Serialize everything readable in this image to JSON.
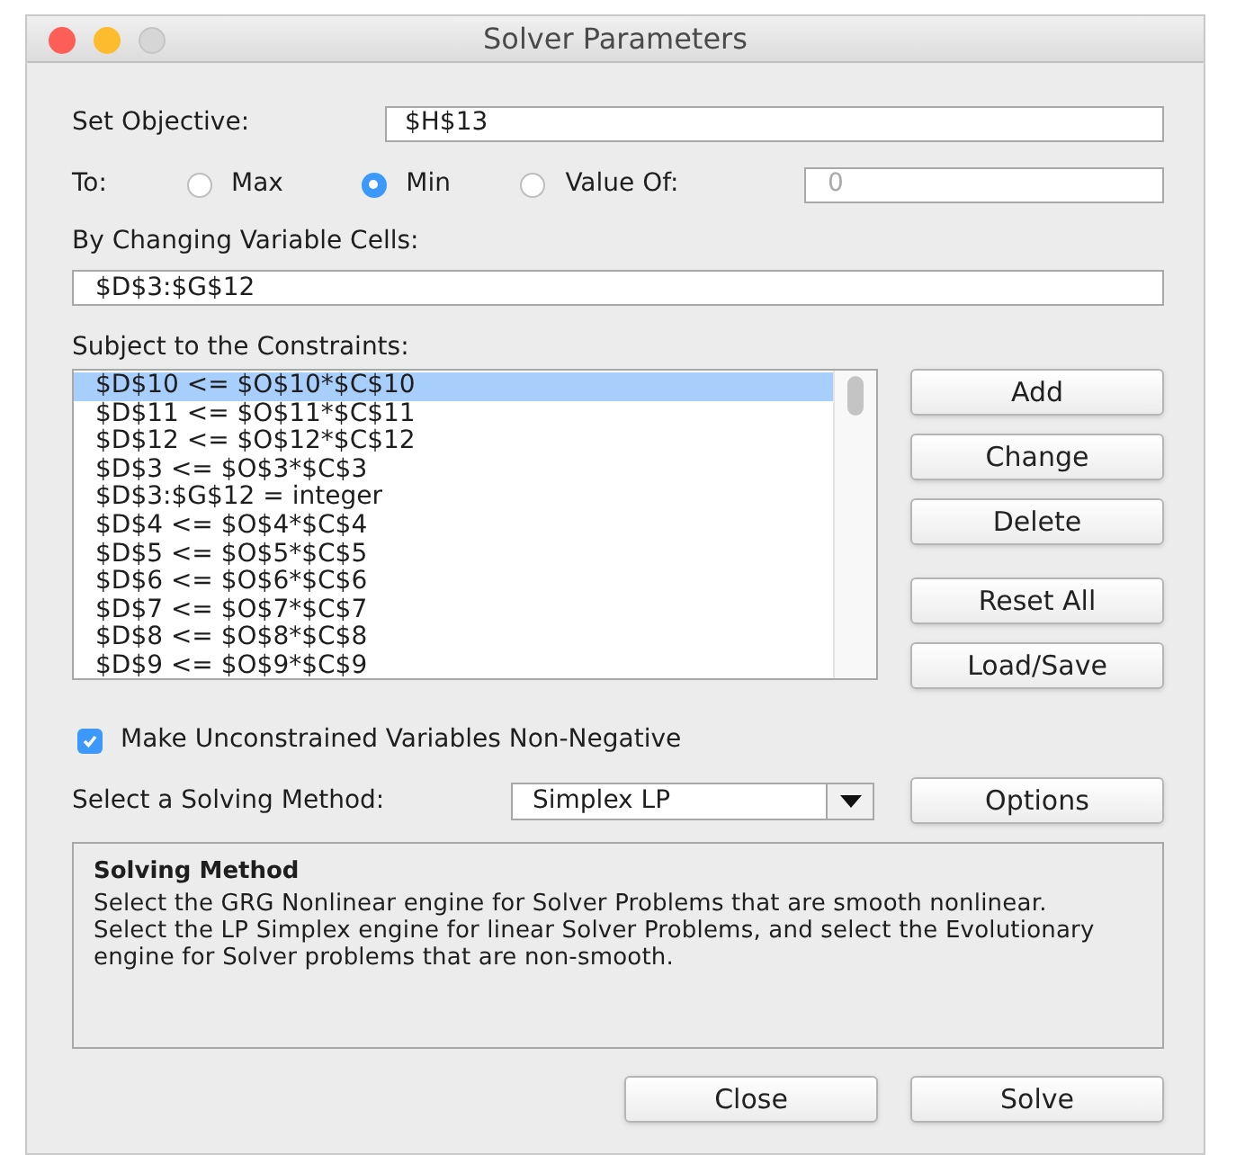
{
  "window": {
    "title": "Solver Parameters"
  },
  "objective": {
    "label": "Set Objective:",
    "value": "$H$13"
  },
  "to": {
    "label": "To:",
    "options": [
      {
        "label": "Max",
        "selected": false
      },
      {
        "label": "Min",
        "selected": true
      },
      {
        "label": "Value Of:",
        "selected": false
      }
    ],
    "value_field": {
      "placeholder": "0"
    }
  },
  "variable_cells": {
    "label": "By Changing Variable Cells:",
    "value": "$D$3:$G$12"
  },
  "constraints": {
    "label": "Subject to the Constraints:",
    "items": [
      {
        "text": "$D$10 <= $O$10*$C$10",
        "selected": true
      },
      {
        "text": "$D$11 <= $O$11*$C$11",
        "selected": false
      },
      {
        "text": "$D$12 <= $O$12*$C$12",
        "selected": false
      },
      {
        "text": "$D$3 <= $O$3*$C$3",
        "selected": false
      },
      {
        "text": "$D$3:$G$12 = integer",
        "selected": false
      },
      {
        "text": "$D$4 <= $O$4*$C$4",
        "selected": false
      },
      {
        "text": "$D$5 <= $O$5*$C$5",
        "selected": false
      },
      {
        "text": "$D$6 <= $O$6*$C$6",
        "selected": false
      },
      {
        "text": "$D$7 <= $O$7*$C$7",
        "selected": false
      },
      {
        "text": "$D$8 <= $O$8*$C$8",
        "selected": false
      },
      {
        "text": "$D$9 <= $O$9*$C$9",
        "selected": false
      }
    ],
    "buttons": [
      "Add",
      "Change",
      "Delete",
      "Reset All",
      "Load/Save"
    ]
  },
  "non_negative": {
    "label": "Make Unconstrained Variables Non-Negative",
    "checked": true
  },
  "method": {
    "label": "Select a Solving Method:",
    "value": "Simplex LP",
    "options_button": "Options"
  },
  "description": {
    "title": "Solving Method",
    "text": "Select the GRG Nonlinear engine for Solver Problems that are smooth nonlinear. Select the LP Simplex engine for linear Solver Problems, and select the Evolutionary engine for Solver problems that are non-smooth."
  },
  "footer_buttons": [
    "Close",
    "Solve"
  ]
}
